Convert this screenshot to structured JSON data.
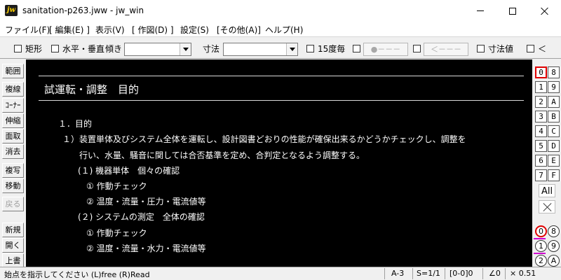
{
  "window": {
    "title": "sanitation-p263.jww - jw_win",
    "icon_label": "jw"
  },
  "menu": [
    "ファイル(F)",
    "[ 編集(E) ]",
    "表示(V)",
    "[ 作図(D) ]",
    "設定(S)",
    "[その他(A)]",
    "ヘルプ(H)"
  ],
  "toolbar": {
    "rect_label": "矩形",
    "hv_label": "水平・垂直",
    "tilt_label": "傾き",
    "tilt_value": "",
    "dim_label": "寸法",
    "dim_value": "",
    "deg15_label": "15度毎",
    "btn1_label": "●－－－",
    "btn2_label": "＜－－－",
    "dimval_label": "寸法値",
    "lt_label": "＜"
  },
  "left_tools": [
    "範囲",
    "複線",
    "ｺｰﾅｰ",
    "伸縮",
    "面取",
    "消去",
    "複写",
    "移動",
    "戻る",
    "新規",
    "開く",
    "上書"
  ],
  "canvas": {
    "title": "試運転・調整　目的",
    "lines": [
      "１．目的",
      "１）装置単体及びシステム全体を運転し、設計図書どおりの性能が確保出来るかどうかチェックし、調整を",
      "行い、水量、騒音に関しては合否基準を定め、合判定となるよう調整する。",
      "(１) 機器単体　個々の確認",
      "①  作動チェック",
      "②  温度・流量・圧力・電流値等",
      "(２) システムの測定　全体の確認",
      "①  作動チェック",
      "②  温度・流量・水力・電流値等"
    ]
  },
  "layers": {
    "left": [
      "0",
      "1",
      "2",
      "3",
      "4",
      "5",
      "6",
      "7"
    ],
    "right": [
      "8",
      "9",
      "A",
      "B",
      "C",
      "D",
      "E",
      "F"
    ],
    "all_label": "All",
    "groups_left": [
      "0",
      "1",
      "2"
    ],
    "groups_right": [
      "8",
      "9",
      "A"
    ]
  },
  "status": {
    "message": "始点を指示してください (L)free  (R)Read",
    "paper": "A-3",
    "scale": "S=1/1",
    "layer": "[0-0]0",
    "angle": "∠0",
    "zoom": "× 0.51"
  }
}
